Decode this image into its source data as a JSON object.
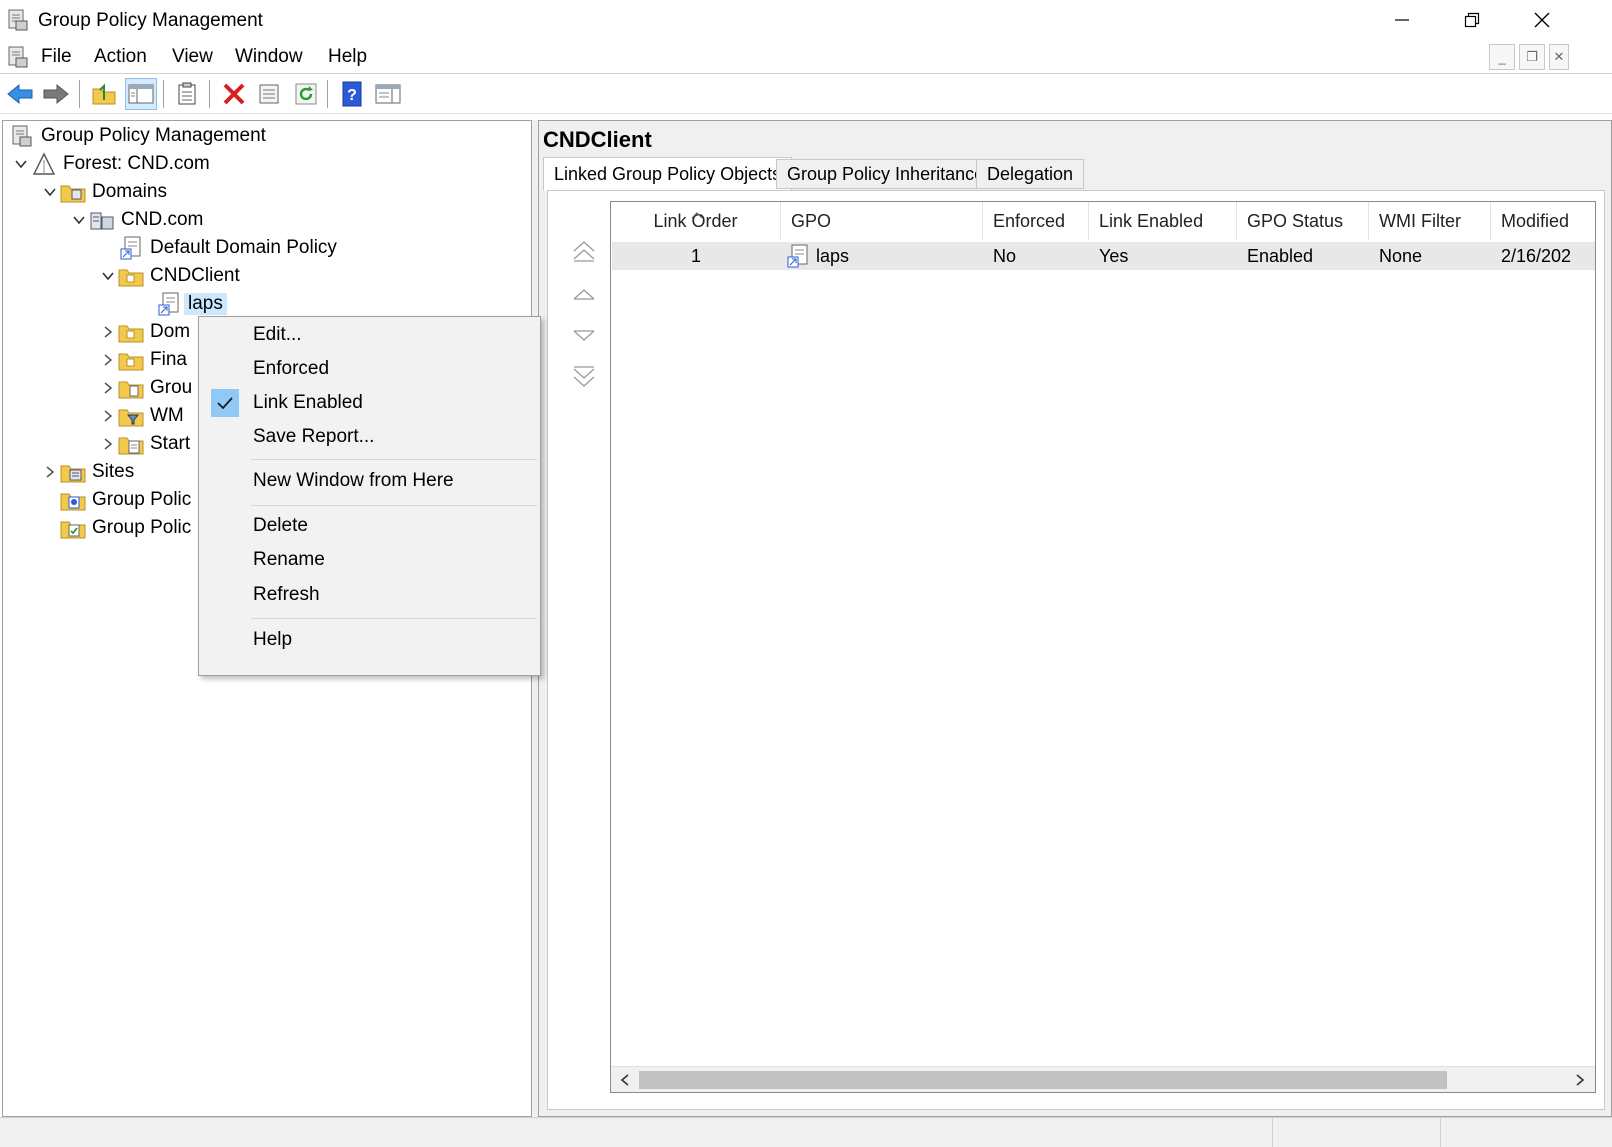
{
  "window": {
    "title": "Group Policy Management",
    "controls": {
      "minimize": "—",
      "restore": "❐",
      "close": "✕"
    }
  },
  "menu": [
    "File",
    "Action",
    "View",
    "Window",
    "Help"
  ],
  "mdi_controls": {
    "minimize": "_",
    "restore": "❐",
    "close": "✕"
  },
  "toolbar_icons": [
    "back-arrow",
    "forward-arrow",
    "up-folder",
    "show-hide-tree",
    "export-list",
    "delete",
    "properties",
    "refresh",
    "help",
    "show-action-pane"
  ],
  "tree": {
    "root": "Group Policy Management",
    "forest": "Forest: CND.com",
    "domains": "Domains",
    "domain": "CND.com",
    "default_policy": "Default Domain Policy",
    "ou": "CNDClient",
    "gpo_link": "laps",
    "truncated": [
      "Dom",
      "Fina",
      "Grou",
      "WM",
      "Start"
    ],
    "sites": "Sites",
    "gp_modeling": "Group Polic",
    "gp_results": "Group Polic"
  },
  "right": {
    "title": "CNDClient",
    "tabs": [
      "Linked Group Policy Objects",
      "Group Policy Inheritance",
      "Delegation"
    ],
    "columns": [
      "Link Order",
      "GPO",
      "Enforced",
      "Link Enabled",
      "GPO Status",
      "WMI Filter",
      "Modified"
    ],
    "rows": [
      {
        "link_order": "1",
        "gpo": "laps",
        "enforced": "No",
        "link_enabled": "Yes",
        "gpo_status": "Enabled",
        "wmi_filter": "None",
        "modified": "2/16/202"
      }
    ]
  },
  "context_menu": {
    "items": [
      "Edit...",
      "Enforced",
      "Link Enabled",
      "Save Report...",
      "New Window from Here",
      "Delete",
      "Rename",
      "Refresh",
      "Help"
    ],
    "checked": "Link Enabled"
  },
  "colors": {
    "selection": "#cce8ff",
    "check_highlight": "#90c8f6",
    "accent": "#0078d7"
  }
}
